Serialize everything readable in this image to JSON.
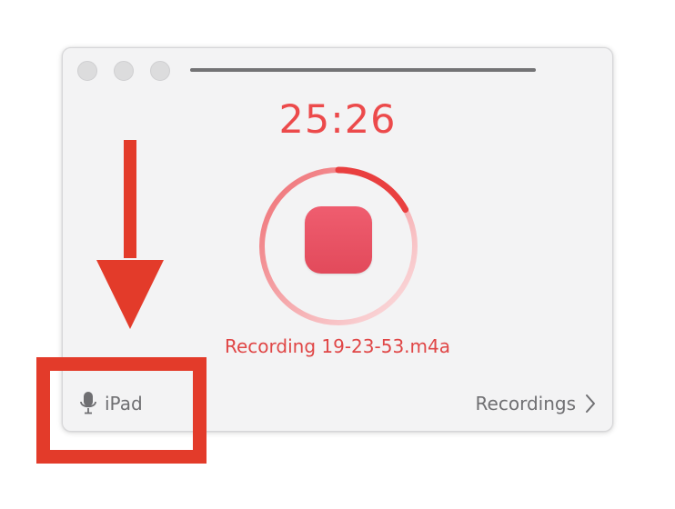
{
  "window": {
    "controls": [
      "close",
      "minimize",
      "zoom"
    ]
  },
  "recorder": {
    "elapsed_time": "25:26",
    "progress_fraction": 0.17,
    "filename": "Recording 19-23-53.m4a",
    "input_device": "iPad",
    "recordings_label": "Recordings"
  },
  "colors": {
    "accent_red": "#ec4a4b",
    "stop_button": "#e24a5b",
    "annotation_red": "#e33b2a",
    "secondary_text": "#6f6f72"
  },
  "icons": {
    "device": "microphone-icon",
    "recordings": "chevron-right-icon",
    "annotation": "down-arrow-icon"
  }
}
